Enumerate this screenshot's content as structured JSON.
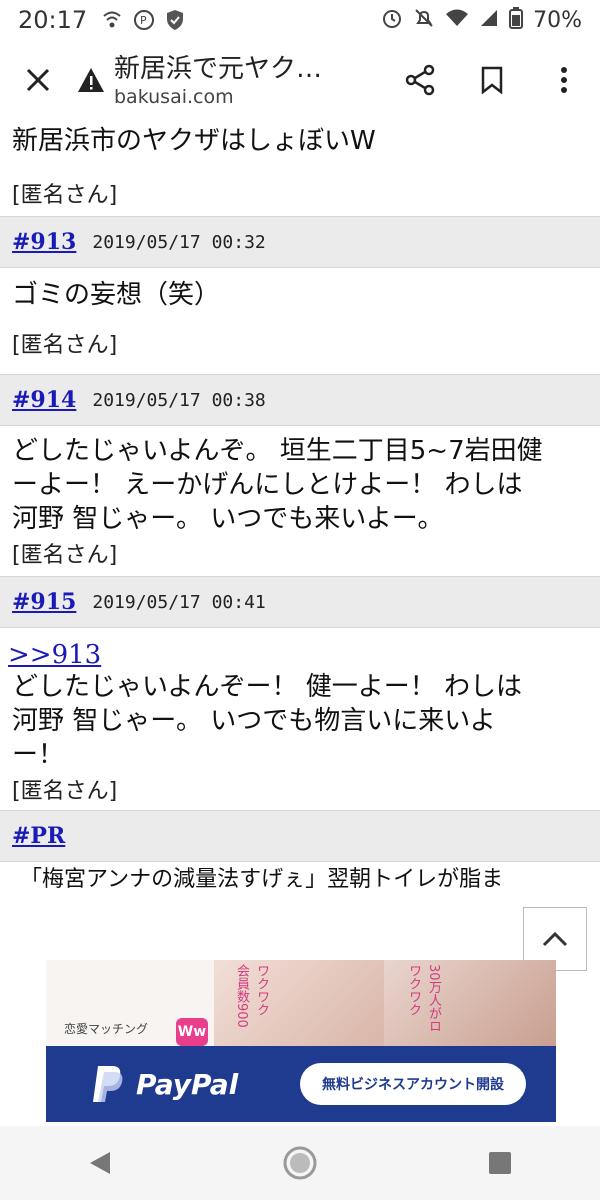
{
  "status_bar": {
    "time": "20:17",
    "battery": "70%"
  },
  "browser": {
    "title": "新居浜で元ヤク…",
    "url": "bakusai.com"
  },
  "posts": [
    {
      "body": "新居浜市のヤクザはしょぼいW",
      "author": "[匿名さん]"
    },
    {
      "number": "#913",
      "date": "2019/05/17 00:32",
      "body": "ゴミの妄想（笑）",
      "author": "[匿名さん]"
    },
    {
      "number": "#914",
      "date": "2019/05/17 00:38",
      "body_lines": [
        "どしたじゃいよんぞ。 垣生二丁目5~7岩田健",
        "ーよー！ えーかげんにしとけよー！ わしは",
        "河野 智じゃー。 いつでも来いよー。"
      ],
      "author": "[匿名さん]"
    },
    {
      "number": "#915",
      "date": "2019/05/17 00:41",
      "reply_to": ">>913",
      "body_lines": [
        "どしたじゃいよんぞー！ 健一よー！ わしは",
        "河野 智じゃー。 いつでも物言いに来いよ",
        "ー！"
      ],
      "author": "[匿名さん]"
    }
  ],
  "pr": {
    "label": "#PR",
    "text": "「梅宮アンナの減量法すげぇ」翌朝トイレが脂ま"
  },
  "ad": {
    "label": "恋愛マッチング",
    "logo": "Ww",
    "vertical_1": "会員数900",
    "vertical_2": "ワクワク",
    "vertical_3": "30万人がロ",
    "paypal_name": "PayPal",
    "paypal_button": "無料ビジネスアカウント開設"
  },
  "colors": {
    "link": "#1a1ab8",
    "header_bg": "#ebebeb",
    "paypal_blue": "#1f3b8f"
  }
}
